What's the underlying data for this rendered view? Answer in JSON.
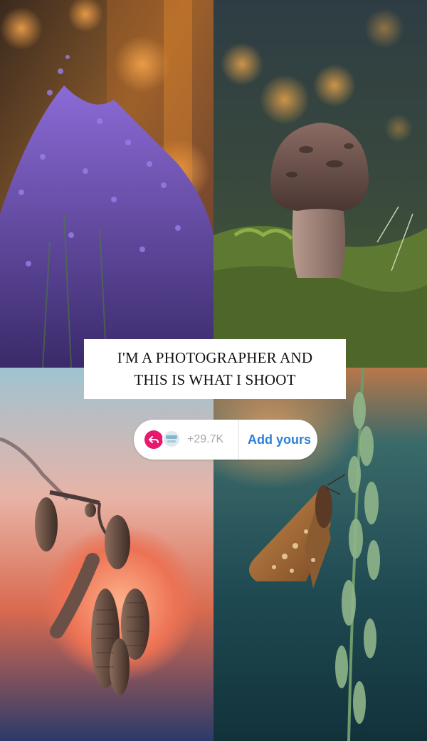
{
  "caption": {
    "line1": "I'M A PHOTOGRAPHER AND",
    "line2": "THIS IS WHAT I SHOOT"
  },
  "sticker": {
    "count": "+29.7K",
    "action_label": "Add yours",
    "reply_icon": "reply-arrow-icon",
    "accent_color": "#e6196e",
    "link_color": "#2b7fd9"
  },
  "photos": [
    {
      "subject": "heather",
      "name": "photo-heather"
    },
    {
      "subject": "mushroom",
      "name": "photo-mushroom"
    },
    {
      "subject": "alder catkins",
      "name": "photo-catkins"
    },
    {
      "subject": "butterfly on grass",
      "name": "photo-butterfly"
    }
  ]
}
